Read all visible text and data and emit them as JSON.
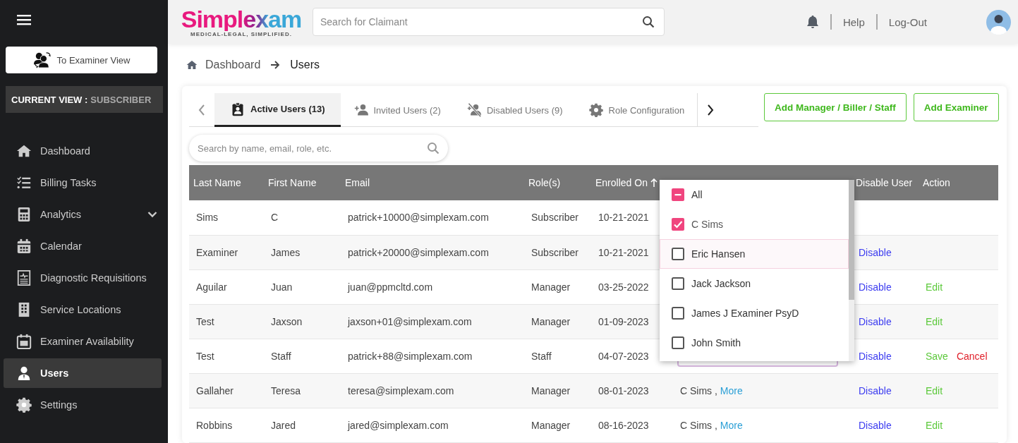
{
  "sidebar": {
    "view_button": "To Examiner View",
    "current_view": {
      "label": "CURRENT VIEW :",
      "value": "SUBSCRIBER"
    },
    "items": [
      {
        "label": "Dashboard",
        "kind": "link",
        "selected": false
      },
      {
        "label": "Billing Tasks",
        "kind": "link",
        "selected": false
      },
      {
        "label": "Analytics",
        "kind": "group",
        "selected": false
      },
      {
        "label": "Calendar",
        "kind": "link",
        "selected": false
      },
      {
        "label": "Diagnostic Requisitions",
        "kind": "link",
        "selected": false
      },
      {
        "label": "Service Locations",
        "kind": "link",
        "selected": false
      },
      {
        "label": "Examiner Availability",
        "kind": "link",
        "selected": false
      },
      {
        "label": "Users",
        "kind": "link",
        "selected": true
      },
      {
        "label": "Settings",
        "kind": "link",
        "selected": false
      }
    ]
  },
  "header": {
    "logo": "Simplexam",
    "tagline": "MEDICAL-LEGAL, SIMPLIFIED.",
    "search": {
      "placeholder": "Search for Claimant"
    },
    "links": [
      "Help",
      "Log-Out"
    ]
  },
  "breadcrumb": [
    "Dashboard",
    "Users"
  ],
  "tabs": [
    {
      "label": "Active Users (13)",
      "selected": true
    },
    {
      "label": "Invited Users (2)",
      "selected": false
    },
    {
      "label": "Disabled Users (9)",
      "selected": false
    },
    {
      "label": "Role Configuration",
      "selected": false
    }
  ],
  "buttons": [
    "Add Manager / Biller / Staff",
    "Add Examiner"
  ],
  "table_search": {
    "placeholder": "Search by name, email, role, etc."
  },
  "table": {
    "columns": [
      {
        "label": "Last Name",
        "sorted": false
      },
      {
        "label": "First Name",
        "sorted": false
      },
      {
        "label": "Email",
        "sorted": false
      },
      {
        "label": "Role(s)",
        "sorted": false
      },
      {
        "label": "Enrolled On",
        "sorted": true
      },
      {},
      {
        "label": "Disable User",
        "sorted": false
      },
      {
        "label": "Action",
        "sorted": false
      }
    ],
    "rows": [
      {
        "cells": [
          "Sims",
          "C",
          "patrick+10000@simplexam.com",
          "Subscriber",
          "10-21-2021"
        ],
        "assigned": {
          "kind": "hidden"
        }
      },
      {
        "cells": [
          "Examiner",
          "James",
          "patrick+20000@simplexam.com",
          "Subscriber",
          "10-21-2021"
        ],
        "assigned": {
          "kind": "hidden"
        },
        "disable": "Disable"
      },
      {
        "cells": [
          "Aguilar",
          "Juan",
          "juan@ppmcltd.com",
          "Manager",
          "03-25-2022"
        ],
        "assigned": {
          "kind": "hidden"
        },
        "disable": "Disable",
        "actions": [
          {
            "label": "Edit",
            "kind": "edit"
          }
        ]
      },
      {
        "cells": [
          "Test",
          "Jaxson",
          "jaxson+01@simplexam.com",
          "Manager",
          "01-09-2023"
        ],
        "assigned": {
          "kind": "hidden"
        },
        "disable": "Disable",
        "actions": [
          {
            "label": "Edit",
            "kind": "edit"
          }
        ]
      },
      {
        "cells": [
          "Test",
          "Staff",
          "patrick+88@simplexam.com",
          "Staff",
          "04-07-2023"
        ],
        "assigned": {
          "kind": "field"
        },
        "disable": "Disable",
        "actions": [
          {
            "label": "Save",
            "kind": "save"
          },
          {
            "label": "Cancel",
            "kind": "cancel"
          }
        ]
      },
      {
        "cells": [
          "Gallaher",
          "Teresa",
          "teresa@simplexam.com",
          "Manager",
          "08-01-2023"
        ],
        "assigned": {
          "kind": "text",
          "name": "C  Sims ,",
          "more": "More"
        },
        "disable": "Disable",
        "actions": [
          {
            "label": "Edit",
            "kind": "edit"
          }
        ]
      },
      {
        "cells": [
          "Robbins",
          "Jared",
          "jared@simplexam.com",
          "Manager",
          "08-16-2023"
        ],
        "assigned": {
          "kind": "text",
          "name": "C  Sims ,",
          "more": "More"
        },
        "disable": "Disable",
        "actions": [
          {
            "label": "Edit",
            "kind": "edit"
          }
        ]
      }
    ]
  },
  "dropdown": {
    "options": [
      {
        "label": "All",
        "checked": false,
        "mixed": true,
        "highlighted": false
      },
      {
        "label": "C Sims",
        "checked": true,
        "mixed": false,
        "highlighted": false
      },
      {
        "label": "Eric Hansen",
        "checked": false,
        "mixed": false,
        "highlighted": true
      },
      {
        "label": "Jack Jackson",
        "checked": false,
        "mixed": false,
        "highlighted": false
      },
      {
        "label": "James J Examiner PsyD",
        "checked": false,
        "mixed": false,
        "highlighted": false
      },
      {
        "label": "John Smith",
        "checked": false,
        "mixed": false,
        "highlighted": false
      }
    ]
  }
}
